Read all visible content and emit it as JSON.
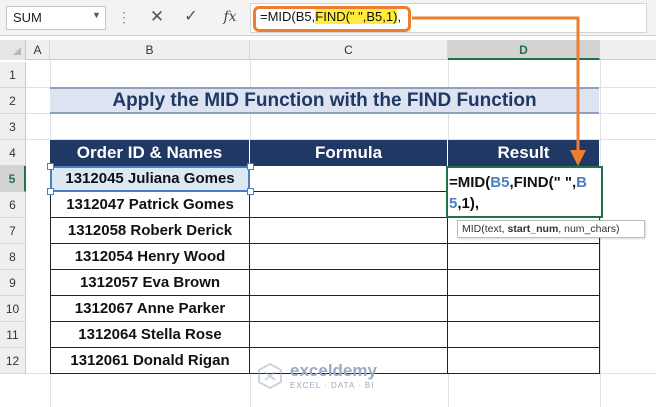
{
  "formula_bar": {
    "name_box": "SUM",
    "fx_label": "fx",
    "formula_part1": "=MID(B5,",
    "formula_highlight": "FIND(\" \",B5,1)",
    "formula_part3": ","
  },
  "columns": [
    "A",
    "B",
    "C",
    "D"
  ],
  "rows": [
    "1",
    "2",
    "3",
    "4",
    "5",
    "6",
    "7",
    "8",
    "9",
    "10",
    "11",
    "12"
  ],
  "title": "Apply the MID Function with the FIND Function",
  "table": {
    "headers": [
      "Order ID & Names",
      "Formula",
      "Result"
    ],
    "names": [
      "1312045 Juliana Gomes",
      "1312047 Patrick Gomes",
      "1312058 Roberk Derick",
      "1312054 Henry Wood",
      "1312057 Eva Brown",
      "1312067 Anne Parker",
      "1312064 Stella Rose",
      "1312061 Donald Rigan"
    ]
  },
  "edit_cell": {
    "p1": "=MID(",
    "ref1": "B5",
    "p2": ",FIND(\" \",",
    "ref2": "B5",
    "p3": ",1),"
  },
  "tooltip": {
    "prefix": "MID(text, ",
    "bold": "start_num",
    "suffix": ", num_chars)"
  },
  "watermark": {
    "name": "exceldemy",
    "sub": "EXCEL · DATA · BI"
  },
  "colors": {
    "header_bg": "#203864",
    "title_bg": "#dde3f0",
    "callout": "#ee7d31",
    "excel_green": "#217346"
  }
}
